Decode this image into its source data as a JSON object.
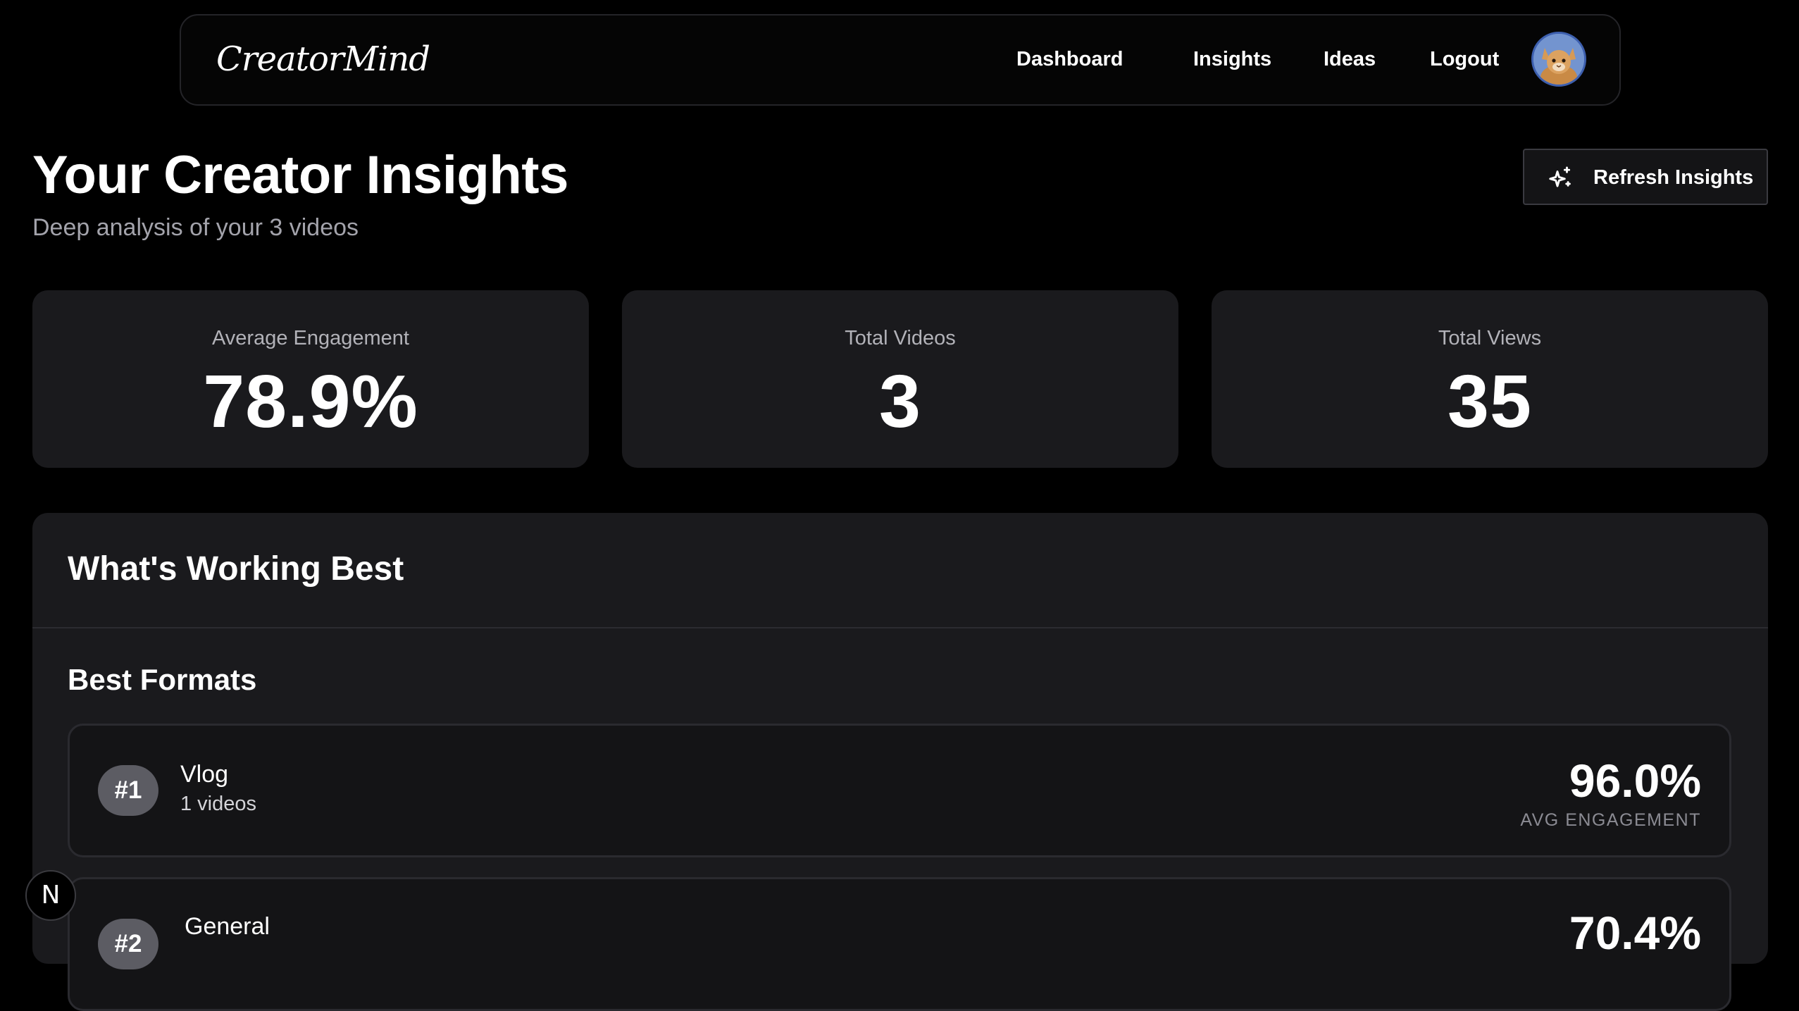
{
  "nav": {
    "logo": "CreatorMind",
    "links": [
      "Dashboard",
      "Insights",
      "Ideas",
      "Logout"
    ],
    "avatar_icon": "cat-avatar-icon"
  },
  "header": {
    "title": "Your Creator Insights",
    "subtitle": "Deep analysis of your 3 videos",
    "refresh_label": "Refresh Insights",
    "refresh_icon": "sparkles-icon"
  },
  "stats": [
    {
      "label": "Average Engagement",
      "value": "78.9%"
    },
    {
      "label": "Total Videos",
      "value": "3"
    },
    {
      "label": "Total Views",
      "value": "35"
    }
  ],
  "working_best": {
    "title": "What's Working Best",
    "best_formats": {
      "title": "Best Formats",
      "items": [
        {
          "rank": "#1",
          "name": "Vlog",
          "count": "1 videos",
          "engagement": "96.0%",
          "caption": "AVG ENGAGEMENT"
        },
        {
          "rank": "#2",
          "name": "General",
          "count": "",
          "engagement": "70.4%",
          "caption": ""
        }
      ]
    }
  },
  "dev_badge": "N",
  "colors": {
    "background": "#000000",
    "card": "#1a1a1d",
    "badge": "#5c5c63"
  }
}
